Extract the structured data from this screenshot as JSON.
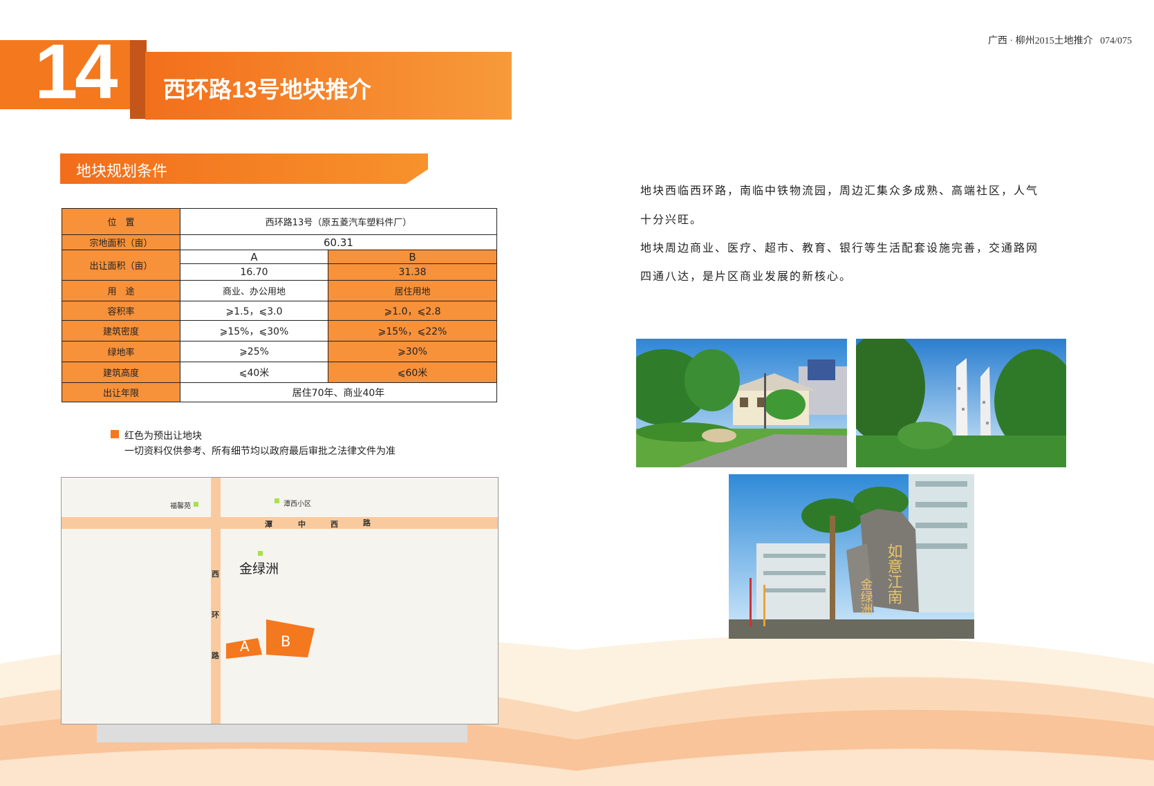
{
  "header": {
    "number": "14",
    "title": "西环路13号地块推介",
    "page_ref": "广西 · 柳州2015土地推介   074/075"
  },
  "section": {
    "title": "地块规划条件"
  },
  "table": {
    "location_label": "位　置",
    "location_value": "西环路13号（原五菱汽车塑料件厂）",
    "total_area_label": "宗地面积（亩）",
    "total_area_value": "60.31",
    "transfer_area_label": "出让面积（亩）",
    "col_a": "A",
    "col_b": "B",
    "area_a": "16.70",
    "area_b": "31.38",
    "rows": [
      {
        "label": "用　途",
        "a": "商业、办公用地",
        "b": "居住用地"
      },
      {
        "label": "容积率",
        "a": "⩾1.5，⩽3.0",
        "b": "⩾1.0，⩽2.8"
      },
      {
        "label": "建筑密度",
        "a": "⩾15%，⩽30%",
        "b": "⩾15%，⩽22%"
      },
      {
        "label": "绿地率",
        "a": "⩾25%",
        "b": "⩾30%"
      },
      {
        "label": "建筑高度",
        "a": "⩽40米",
        "b": "⩽60米"
      }
    ],
    "term_label": "出让年限",
    "term_value": "居住70年、商业40年"
  },
  "legend": {
    "line1": "红色为预出让地块",
    "line2": "一切资料仅供参考、所有细节均以政府最后审批之法律文件为准"
  },
  "map": {
    "place1": "福馨苑",
    "place2": "潭西小区",
    "road_h": [
      "潭",
      "中",
      "西",
      "路"
    ],
    "road_v": [
      "西",
      "环",
      "路"
    ],
    "landmark": "金绿洲",
    "plot_a": "A",
    "plot_b": "B",
    "colors": {
      "road": "#f8ca9e",
      "plot": "#f4781e",
      "marker": "#a9e04f"
    }
  },
  "description": {
    "p1_line1": "地块西临西环路，南临中铁物流园，周边汇集众多成熟、高端社区，人气",
    "p1_line2": "十分兴旺。",
    "p2_line1": "地块周边商业、医疗、超市、教育、银行等生活配套设施完善，交通路网",
    "p2_line2": "四通八达，是片区商业发展的新核心。"
  },
  "photos": [
    {
      "name": "villa-street-photo"
    },
    {
      "name": "tower-sculpture-photo"
    },
    {
      "name": "entrance-stone-photo",
      "stone_text": "如意江南",
      "stone_text2": "金绿洲"
    }
  ],
  "colors": {
    "accent": "#f4781e",
    "accent_dark": "#c4561a",
    "table_label": "#f7913a"
  }
}
